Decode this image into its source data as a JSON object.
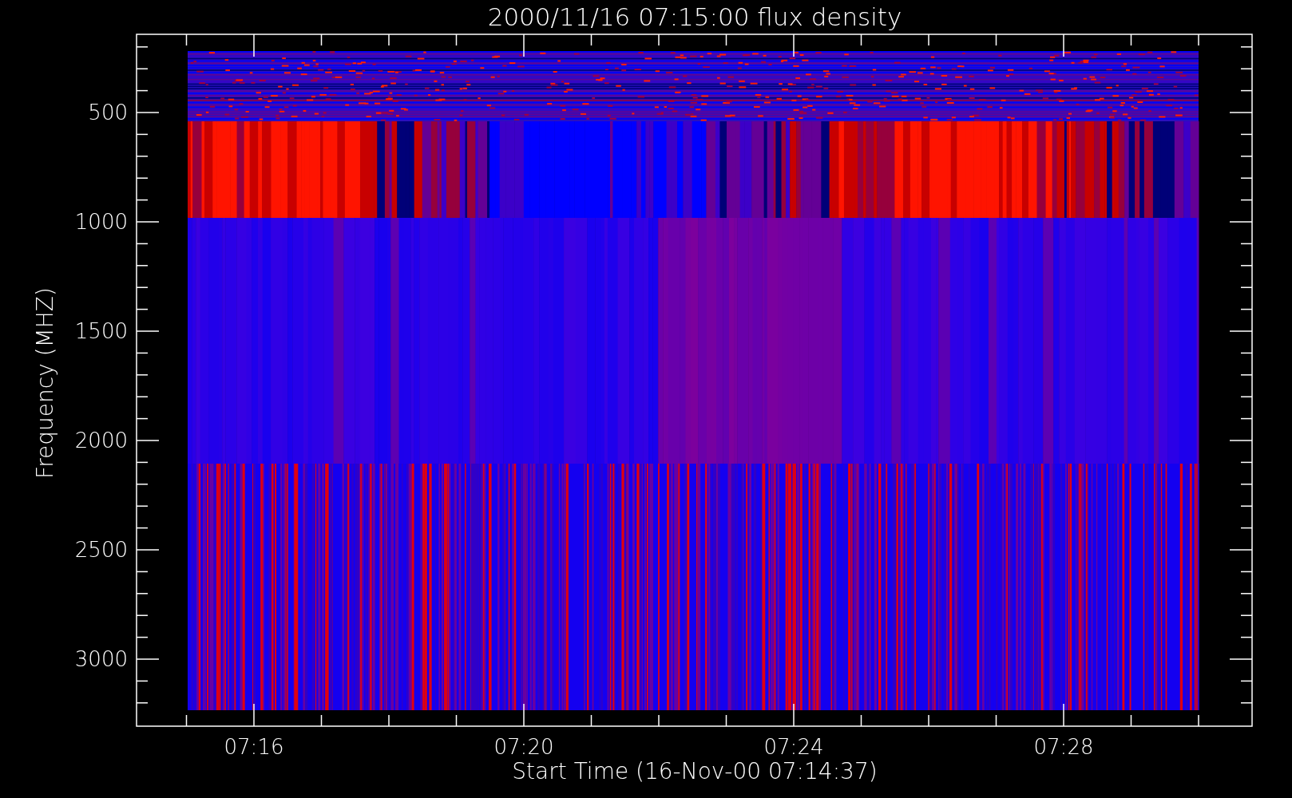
{
  "plot": {
    "title": "2000/11/16 07:15:00 flux density",
    "xlabel": "Start Time (16-Nov-00 07:14:37)",
    "ylabel": "Frequency (MHZ)",
    "x_tick_labels": [
      "07:16",
      "07:20",
      "07:24",
      "07:28"
    ],
    "y_tick_labels": [
      "500",
      "1000",
      "1500",
      "2000",
      "2500",
      "3000"
    ]
  }
}
